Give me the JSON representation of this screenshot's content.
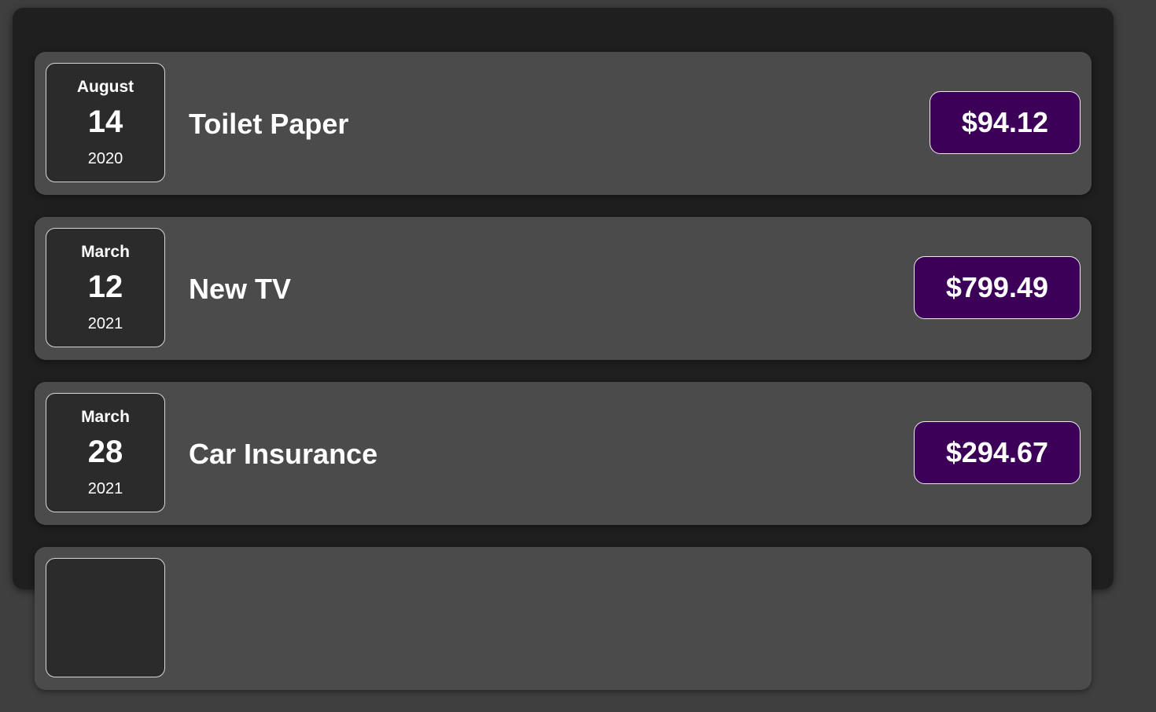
{
  "expenses": [
    {
      "month": "August",
      "day": "14",
      "year": "2020",
      "title": "Toilet Paper",
      "amount": "$94.12"
    },
    {
      "month": "March",
      "day": "12",
      "year": "2021",
      "title": "New TV",
      "amount": "$799.49"
    },
    {
      "month": "March",
      "day": "28",
      "year": "2021",
      "title": "Car Insurance",
      "amount": "$294.67"
    }
  ],
  "colors": {
    "page_background": "#3f3f3f",
    "panel_background": "#1f1f1f",
    "item_background": "#4b4b4b",
    "date_background": "#2b2b2b",
    "amount_background": "#3c0058",
    "text": "#ffffff"
  }
}
